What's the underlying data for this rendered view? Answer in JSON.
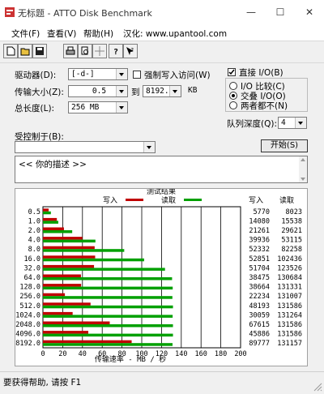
{
  "window": {
    "title": "无标题 - ATTO Disk Benchmark"
  },
  "menu": [
    {
      "label": "文件(F)"
    },
    {
      "label": "查看(V)"
    },
    {
      "label": "帮助(H)"
    },
    {
      "label": "汉化: www.upantool.com"
    }
  ],
  "settings": {
    "drive_label": "驱动器(D):",
    "drive_value": "[-d-]",
    "force_write_label": "强制写入访问(W)",
    "transfer_label": "传输大小(Z):",
    "transfer_from": "0.5",
    "to_label": "到",
    "transfer_to": "8192.0",
    "unit_kb": "KB",
    "total_length_label": "总长度(L):",
    "total_length_value": "256 MB",
    "direct_io_label": "直接 I/O(B)",
    "radio_io_compare": "I/O 比较(C)",
    "radio_overlapped": "交叠 I/O(O)",
    "radio_neither": "两者都不(N)",
    "queue_depth_label": "队列深度(Q):",
    "queue_depth_value": "4",
    "controlled_by_label": "受控制于(B):",
    "controlled_by_value": "",
    "start_button": "开始(S)"
  },
  "description": "<<   你的描述   >>",
  "results": {
    "title": "测试结果",
    "legend_write": "写入",
    "legend_read": "读取",
    "col_write": "写入",
    "col_read": "读取",
    "x_axis_label": "传输速率 - MB / 秒",
    "colors": {
      "write": "#c00000",
      "read": "#00a000"
    }
  },
  "chart_data": {
    "type": "bar",
    "categories": [
      "0.5",
      "1.0",
      "2.0",
      "4.0",
      "8.0",
      "16.0",
      "32.0",
      "64.0",
      "128.0",
      "256.0",
      "512.0",
      "1024.0",
      "2048.0",
      "4096.0",
      "8192.0"
    ],
    "series": [
      {
        "name": "写入",
        "values": [
          5770,
          14080,
          21261,
          39936,
          52332,
          52851,
          51704,
          38475,
          38664,
          22234,
          48193,
          30059,
          67615,
          45886,
          89777
        ]
      },
      {
        "name": "读取",
        "values": [
          8023,
          15538,
          29621,
          53115,
          82258,
          102436,
          123526,
          130684,
          131331,
          131007,
          131586,
          131264,
          131586,
          131586,
          131157
        ]
      }
    ],
    "xlabel": "传输速率 - MB / 秒",
    "xlim": [
      0,
      200
    ],
    "x_ticks": [
      0,
      20,
      40,
      60,
      80,
      100,
      120,
      140,
      160,
      180,
      200
    ]
  },
  "status": {
    "text": "要获得帮助, 请按 F1"
  }
}
